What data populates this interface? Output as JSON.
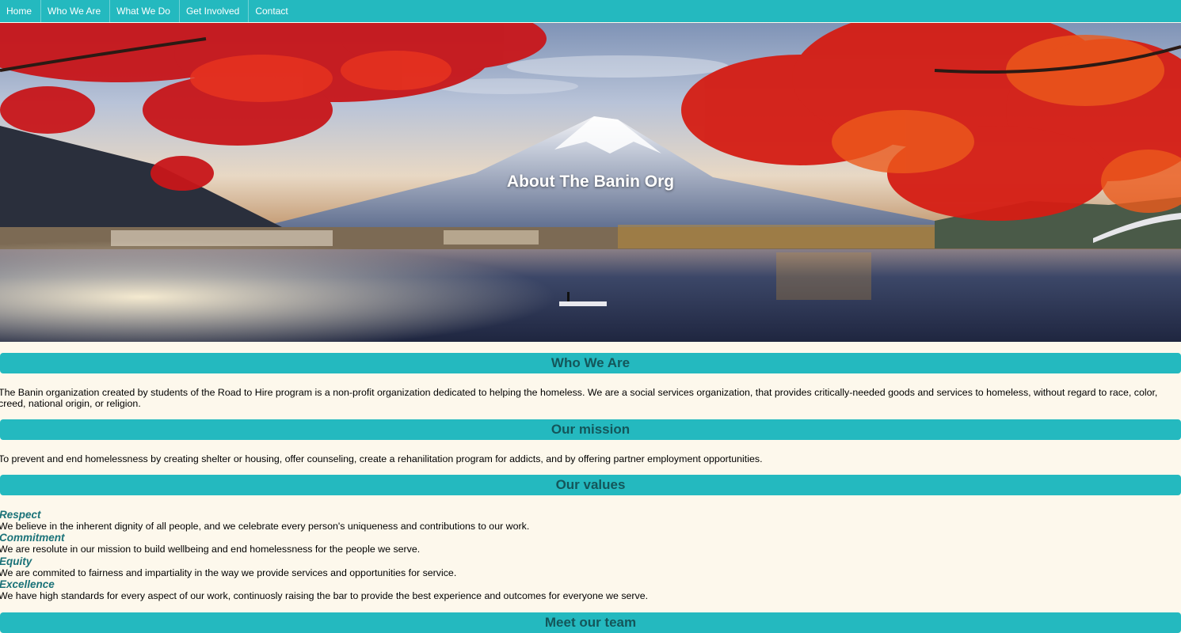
{
  "nav": {
    "items": [
      {
        "label": "Home"
      },
      {
        "label": "Who We Are"
      },
      {
        "label": "What We Do"
      },
      {
        "label": "Get Involved"
      },
      {
        "label": "Contact"
      }
    ]
  },
  "hero": {
    "title": "About The Banin Org",
    "image": "mount-fuji-lake-autumn-maple-image"
  },
  "who_we_are": {
    "heading": "Who We Are",
    "text": "The Banin organization created by students of the Road to Hire program is a non-profit organization dedicated to helping the homeless. We are a social services organization, that provides critically-needed goods and services to homeless, without regard to race, color, creed, national origin, or religion."
  },
  "mission": {
    "heading": "Our mission",
    "text": "To prevent and end homelessness by creating shelter or housing, offer counseling, create a rehanilitation program for addicts, and by offering partner employment opportunities."
  },
  "values": {
    "heading": "Our values",
    "items": [
      {
        "title": "Respect",
        "text": "We believe in the inherent dignity of all people, and we celebrate every person's uniqueness and contributions to our work."
      },
      {
        "title": "Commitment",
        "text": "We are resolute in our mission to build wellbeing and end homelessness for the people we serve."
      },
      {
        "title": "Equity",
        "text": "We are commited to fairness and impartiality in the way we provide services and opportunities for service."
      },
      {
        "title": "Excellence",
        "text": "We have high standards for every aspect of our work, continuosly raising the bar to provide the best experience and outcomes for everyone we serve."
      }
    ]
  },
  "team": {
    "heading": "Meet our team"
  },
  "colors": {
    "accent": "#24b9bf",
    "heading_text": "#14565a",
    "value_title": "#1a7278",
    "background": "#fdf8ec"
  }
}
